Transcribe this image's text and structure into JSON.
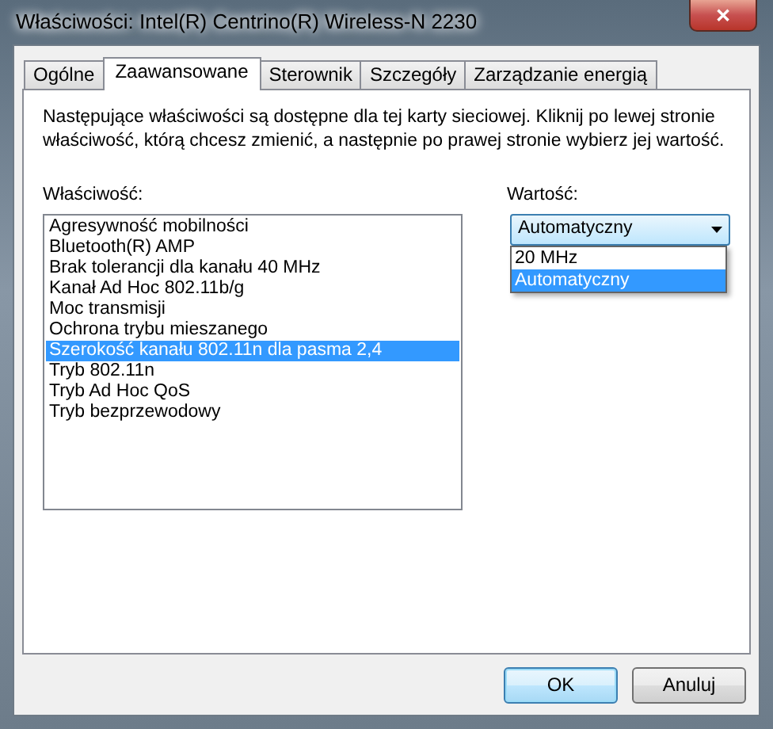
{
  "window": {
    "title": "Właściwości: Intel(R) Centrino(R) Wireless-N 2230",
    "close": "✕"
  },
  "tabs": [
    {
      "label": "Ogólne",
      "selected": false
    },
    {
      "label": "Zaawansowane",
      "selected": true
    },
    {
      "label": "Sterownik",
      "selected": false
    },
    {
      "label": "Szczegóły",
      "selected": false
    },
    {
      "label": "Zarządzanie energią",
      "selected": false
    }
  ],
  "description": "Następujące właściwości są dostępne dla tej karty sieciowej. Kliknij po lewej stronie właściwość, którą chcesz zmienić, a następnie po prawej stronie wybierz jej wartość.",
  "property": {
    "label": "Właściwość:",
    "items": [
      {
        "label": "Agresywność mobilności",
        "selected": false
      },
      {
        "label": "Bluetooth(R) AMP",
        "selected": false
      },
      {
        "label": "Brak tolerancji dla kanału 40 MHz",
        "selected": false
      },
      {
        "label": "Kanał Ad Hoc 802.11b/g",
        "selected": false
      },
      {
        "label": "Moc transmisji",
        "selected": false
      },
      {
        "label": "Ochrona trybu mieszanego",
        "selected": false
      },
      {
        "label": "Szerokość kanału 802.11n dla pasma 2,4",
        "selected": true
      },
      {
        "label": "Tryb 802.11n",
        "selected": false
      },
      {
        "label": "Tryb Ad Hoc QoS",
        "selected": false
      },
      {
        "label": "Tryb bezprzewodowy",
        "selected": false
      }
    ]
  },
  "value": {
    "label": "Wartość:",
    "current": "Automatyczny",
    "expanded": true,
    "options": [
      {
        "label": "20 MHz",
        "selected": false
      },
      {
        "label": "Automatyczny",
        "selected": true
      }
    ]
  },
  "buttons": [
    {
      "label": "OK",
      "default": true
    },
    {
      "label": "Anuluj",
      "default": false
    }
  ]
}
